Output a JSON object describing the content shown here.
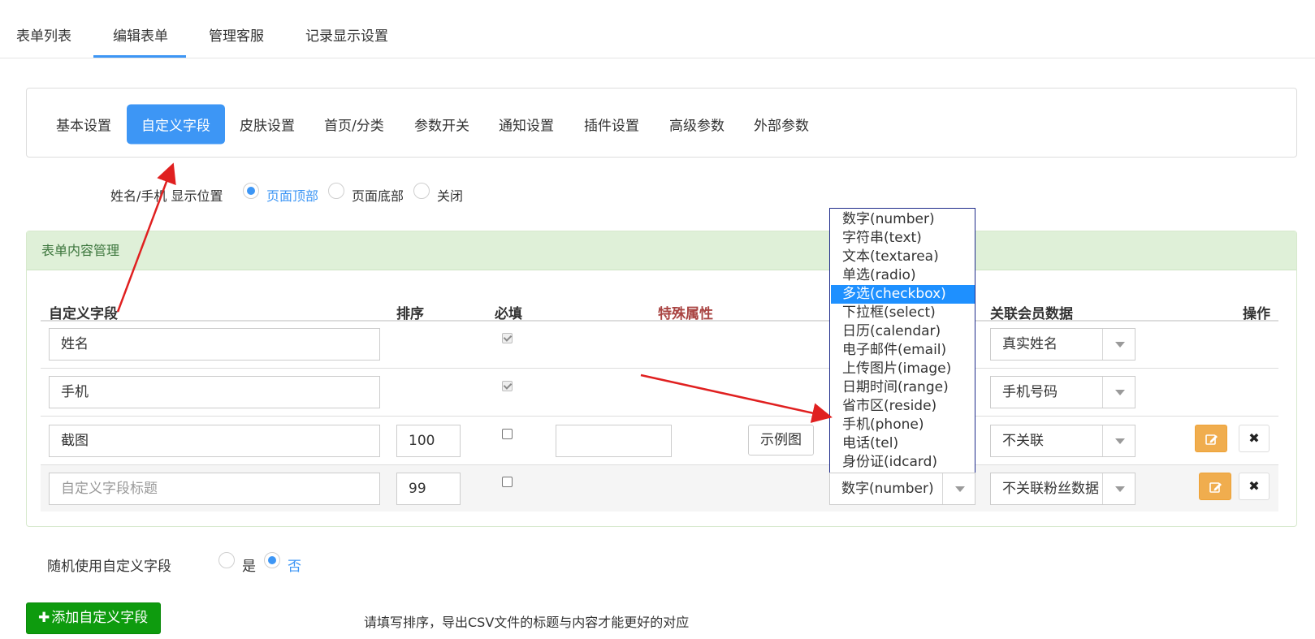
{
  "top_tabs": {
    "items": [
      {
        "label": "表单列表"
      },
      {
        "label": "编辑表单",
        "active": true
      },
      {
        "label": "管理客服"
      },
      {
        "label": "记录显示设置"
      }
    ]
  },
  "sub_tabs": {
    "items": [
      {
        "label": "基本设置"
      },
      {
        "label": "自定义字段",
        "active": true
      },
      {
        "label": "皮肤设置"
      },
      {
        "label": "首页/分类"
      },
      {
        "label": "参数开关"
      },
      {
        "label": "通知设置"
      },
      {
        "label": "插件设置"
      },
      {
        "label": "高级参数"
      },
      {
        "label": "外部参数"
      }
    ]
  },
  "name_phone_position": {
    "label": "姓名/手机 显示位置",
    "options": [
      "页面顶部",
      "页面底部",
      "关闭"
    ],
    "selected": "页面顶部"
  },
  "content_panel": {
    "title": "表单内容管理"
  },
  "table": {
    "headers": {
      "field": "自定义字段",
      "sort": "排序",
      "required": "必填",
      "special": "特殊属性",
      "member": "关联会员数据",
      "action": "操作"
    },
    "rows": [
      {
        "field": "姓名",
        "required": true,
        "member_select": "真实姓名"
      },
      {
        "field": "手机",
        "required": true,
        "member_select": "手机号码"
      },
      {
        "field": "截图",
        "sort": "100",
        "required": false,
        "example_button": "示例图",
        "member_select": "不关联"
      },
      {
        "field_placeholder": "自定义字段标题",
        "sort": "99",
        "required": false,
        "type_select": "数字(number)",
        "member_select": "不关联粉丝数据"
      }
    ]
  },
  "type_dropdown": {
    "options": [
      "数字(number)",
      "字符串(text)",
      "文本(textarea)",
      "单选(radio)",
      "多选(checkbox)",
      "下拉框(select)",
      "日历(calendar)",
      "电子邮件(email)",
      "上传图片(image)",
      "日期时间(range)",
      "省市区(reside)",
      "手机(phone)",
      "电话(tel)",
      "身份证(idcard)"
    ],
    "highlighted": "多选(checkbox)"
  },
  "random_field": {
    "label": "随机使用自定义字段",
    "options": [
      "是",
      "否"
    ],
    "selected": "否"
  },
  "add_button": {
    "icon_glyph": "✚",
    "label": "添加自定义字段"
  },
  "hint": "请填写排序，导出CSV文件的标题与内容才能更好的对应",
  "colors": {
    "primary": "#3d96f5",
    "success": "#0e9b0e",
    "warning": "#f0ad4e",
    "panel_head_bg": "#dff0d8",
    "special_header": "#a94442",
    "annotation_arrow": "#e02020"
  }
}
